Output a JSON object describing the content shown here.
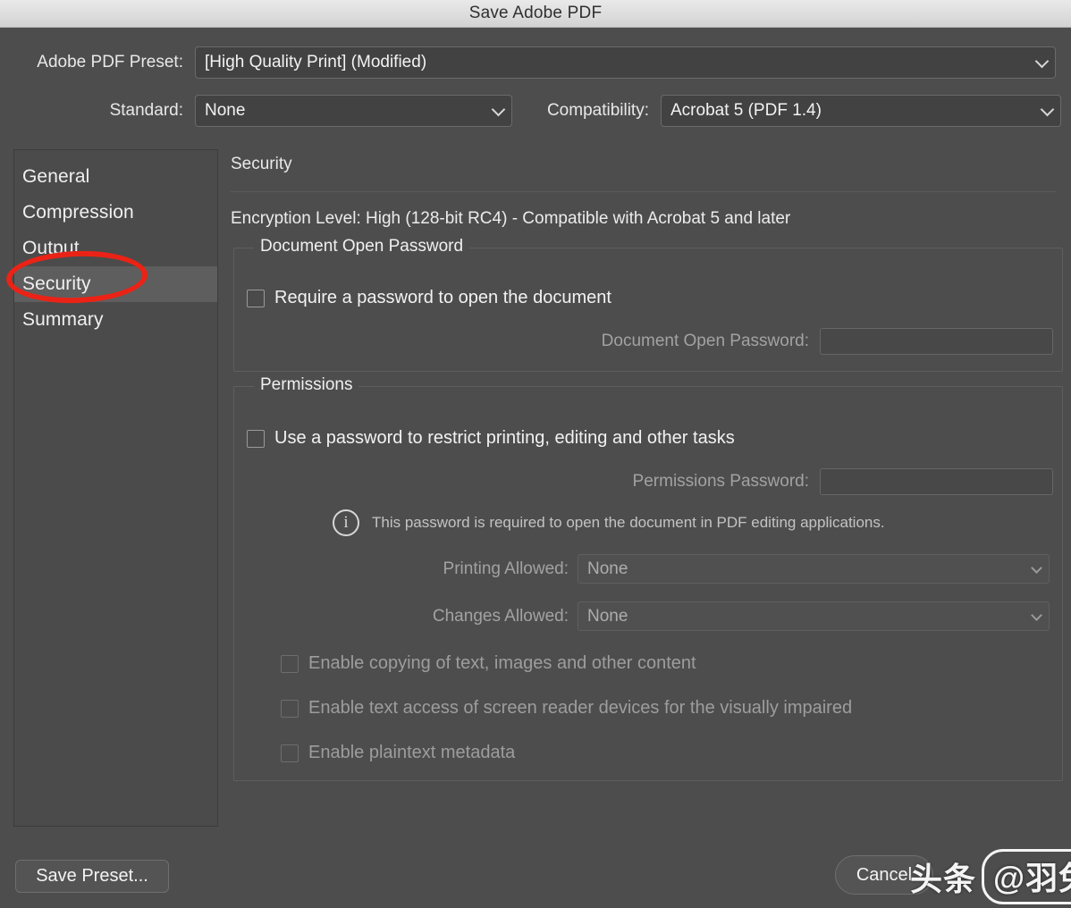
{
  "window": {
    "title": "Save Adobe PDF"
  },
  "top": {
    "preset_label": "Adobe PDF Preset:",
    "preset_value": "[High Quality Print] (Modified)",
    "standard_label": "Standard:",
    "standard_value": "None",
    "compatibility_label": "Compatibility:",
    "compatibility_value": "Acrobat 5 (PDF 1.4)"
  },
  "sidebar": {
    "items": [
      {
        "label": "General",
        "selected": false
      },
      {
        "label": "Compression",
        "selected": false
      },
      {
        "label": "Output",
        "selected": false
      },
      {
        "label": "Security",
        "selected": true
      },
      {
        "label": "Summary",
        "selected": false
      }
    ]
  },
  "pane": {
    "title": "Security",
    "encryption_level": "Encryption Level: High (128-bit RC4) - Compatible with Acrobat 5 and later",
    "document_open_password": {
      "legend": "Document Open Password",
      "require_checkbox_label": "Require a password to open the document",
      "require_checkbox_checked": false,
      "password_label": "Document Open Password:",
      "password_value": ""
    },
    "permissions": {
      "legend": "Permissions",
      "restrict_checkbox_label": "Use a password to restrict printing, editing and other tasks",
      "restrict_checkbox_checked": false,
      "password_label": "Permissions Password:",
      "password_value": "",
      "info_icon": "info-icon",
      "info_text": "This password is required to open the document in PDF editing applications.",
      "printing_label": "Printing Allowed:",
      "printing_value": "None",
      "changes_label": "Changes Allowed:",
      "changes_value": "None",
      "options": [
        {
          "label": "Enable copying of text, images and other content",
          "checked": false
        },
        {
          "label": "Enable text access of screen reader devices for the visually impaired",
          "checked": false
        },
        {
          "label": "Enable plaintext metadata",
          "checked": false
        }
      ]
    }
  },
  "footer": {
    "save_preset_label": "Save Preset...",
    "cancel_label": "Cancel"
  },
  "annotation": {
    "highlight_color": "#ea2316",
    "highlight_target": "Security"
  },
  "watermark": {
    "brand": "头条",
    "handle": "@羽兔网"
  }
}
